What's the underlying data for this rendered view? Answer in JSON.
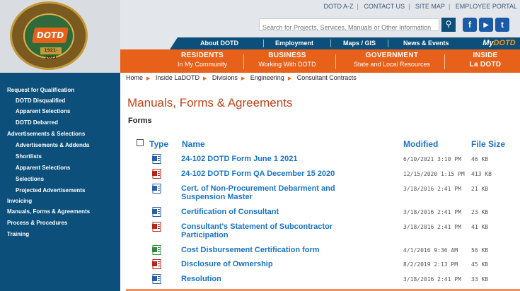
{
  "header": {
    "top_links": [
      "DOTD A-Z",
      "CONTACT US",
      "SITE MAP",
      "EMPLOYEE PORTAL"
    ],
    "search_placeholder": "Search for Projects, Services, Manuals or Other Information",
    "search_icon": "search-icon",
    "social": {
      "facebook": "f",
      "youtube": "▶",
      "twitter": "t"
    },
    "logo_text": "DOTD",
    "logo_years": "1921-2021",
    "nav": [
      "About DOTD",
      "Employment",
      "Maps / GIS",
      "News & Events"
    ],
    "mydotd": {
      "prefix": "My",
      "suffix": "DOTD"
    },
    "audience": [
      {
        "title": "RESIDENTS",
        "sub": "In My Community"
      },
      {
        "title": "BUSINESS",
        "sub": "Working With DOTD"
      },
      {
        "title": "GOVERNMENT",
        "sub": "State and Local Resources"
      },
      {
        "title": "INSIDE",
        "sub": "La DOTD"
      }
    ]
  },
  "sidebar": {
    "items": [
      {
        "label": "Request for Qualification",
        "level": 1
      },
      {
        "label": "DOTD Disqualified",
        "level": 2
      },
      {
        "label": "Apparent Selections",
        "level": 2
      },
      {
        "label": "DOTD Debarred",
        "level": 2
      },
      {
        "label": "Advertisements & Selections",
        "level": 1
      },
      {
        "label": "Advertisements & Addenda",
        "level": 2
      },
      {
        "label": "Shortlists",
        "level": 2
      },
      {
        "label": "Apparent Selections",
        "level": 2
      },
      {
        "label": "Selections",
        "level": 2
      },
      {
        "label": "Projected Advertisements",
        "level": 2
      },
      {
        "label": "Invoicing",
        "level": 1
      },
      {
        "label": "Manuals, Forms & Agreements",
        "level": 1
      },
      {
        "label": "Process & Procedures",
        "level": 1
      },
      {
        "label": "Training",
        "level": 1
      }
    ]
  },
  "breadcrumb": [
    "Home",
    "Inside LaDOTD",
    "Divisions",
    "Engineering",
    "Consultant Contracts"
  ],
  "page_title": "Manuals, Forms & Agreements",
  "section_title": "Forms",
  "table": {
    "columns": {
      "type": "Type",
      "name": "Name",
      "modified": "Modified",
      "size": "File Size"
    },
    "rows": [
      {
        "icon": "word-doc-icon",
        "name": "24-102 DOTD Form June 1 2021",
        "modified": "6/10/2021 3:10 PM",
        "size": "46 KB"
      },
      {
        "icon": "pdf-icon",
        "name": "24-102 DOTD Form QA December 15 2020",
        "modified": "12/15/2020 1:15 PM",
        "size": "413 KB"
      },
      {
        "icon": "word-doc-icon",
        "name": "Cert. of Non-Procurement Debarment and Suspension Master",
        "modified": "3/18/2016 2:41 PM",
        "size": "21 KB"
      },
      {
        "icon": "word-doc-icon",
        "name": "Certification of Consultant",
        "modified": "3/18/2016 2:41 PM",
        "size": "23 KB"
      },
      {
        "icon": "pdf-icon",
        "name": "Consultant's Statement of Subcontractor Participation",
        "modified": "3/18/2016 2:41 PM",
        "size": "41 KB"
      },
      {
        "icon": "excel-icon",
        "name": "Cost Disbursement Certification form",
        "modified": "4/1/2016 9:36 AM",
        "size": "56 KB"
      },
      {
        "icon": "pdf-icon",
        "name": "Disclosure of Ownership",
        "modified": "8/2/2019 2:13 PM",
        "size": "45 KB"
      },
      {
        "icon": "word-doc-icon",
        "name": "Resolution",
        "modified": "3/18/2016 2:41 PM",
        "size": "33 KB"
      }
    ]
  },
  "colors": {
    "orange": "#e8611a",
    "blue": "#0b4f7a",
    "link": "#1a73c7",
    "title": "#c2431a"
  }
}
